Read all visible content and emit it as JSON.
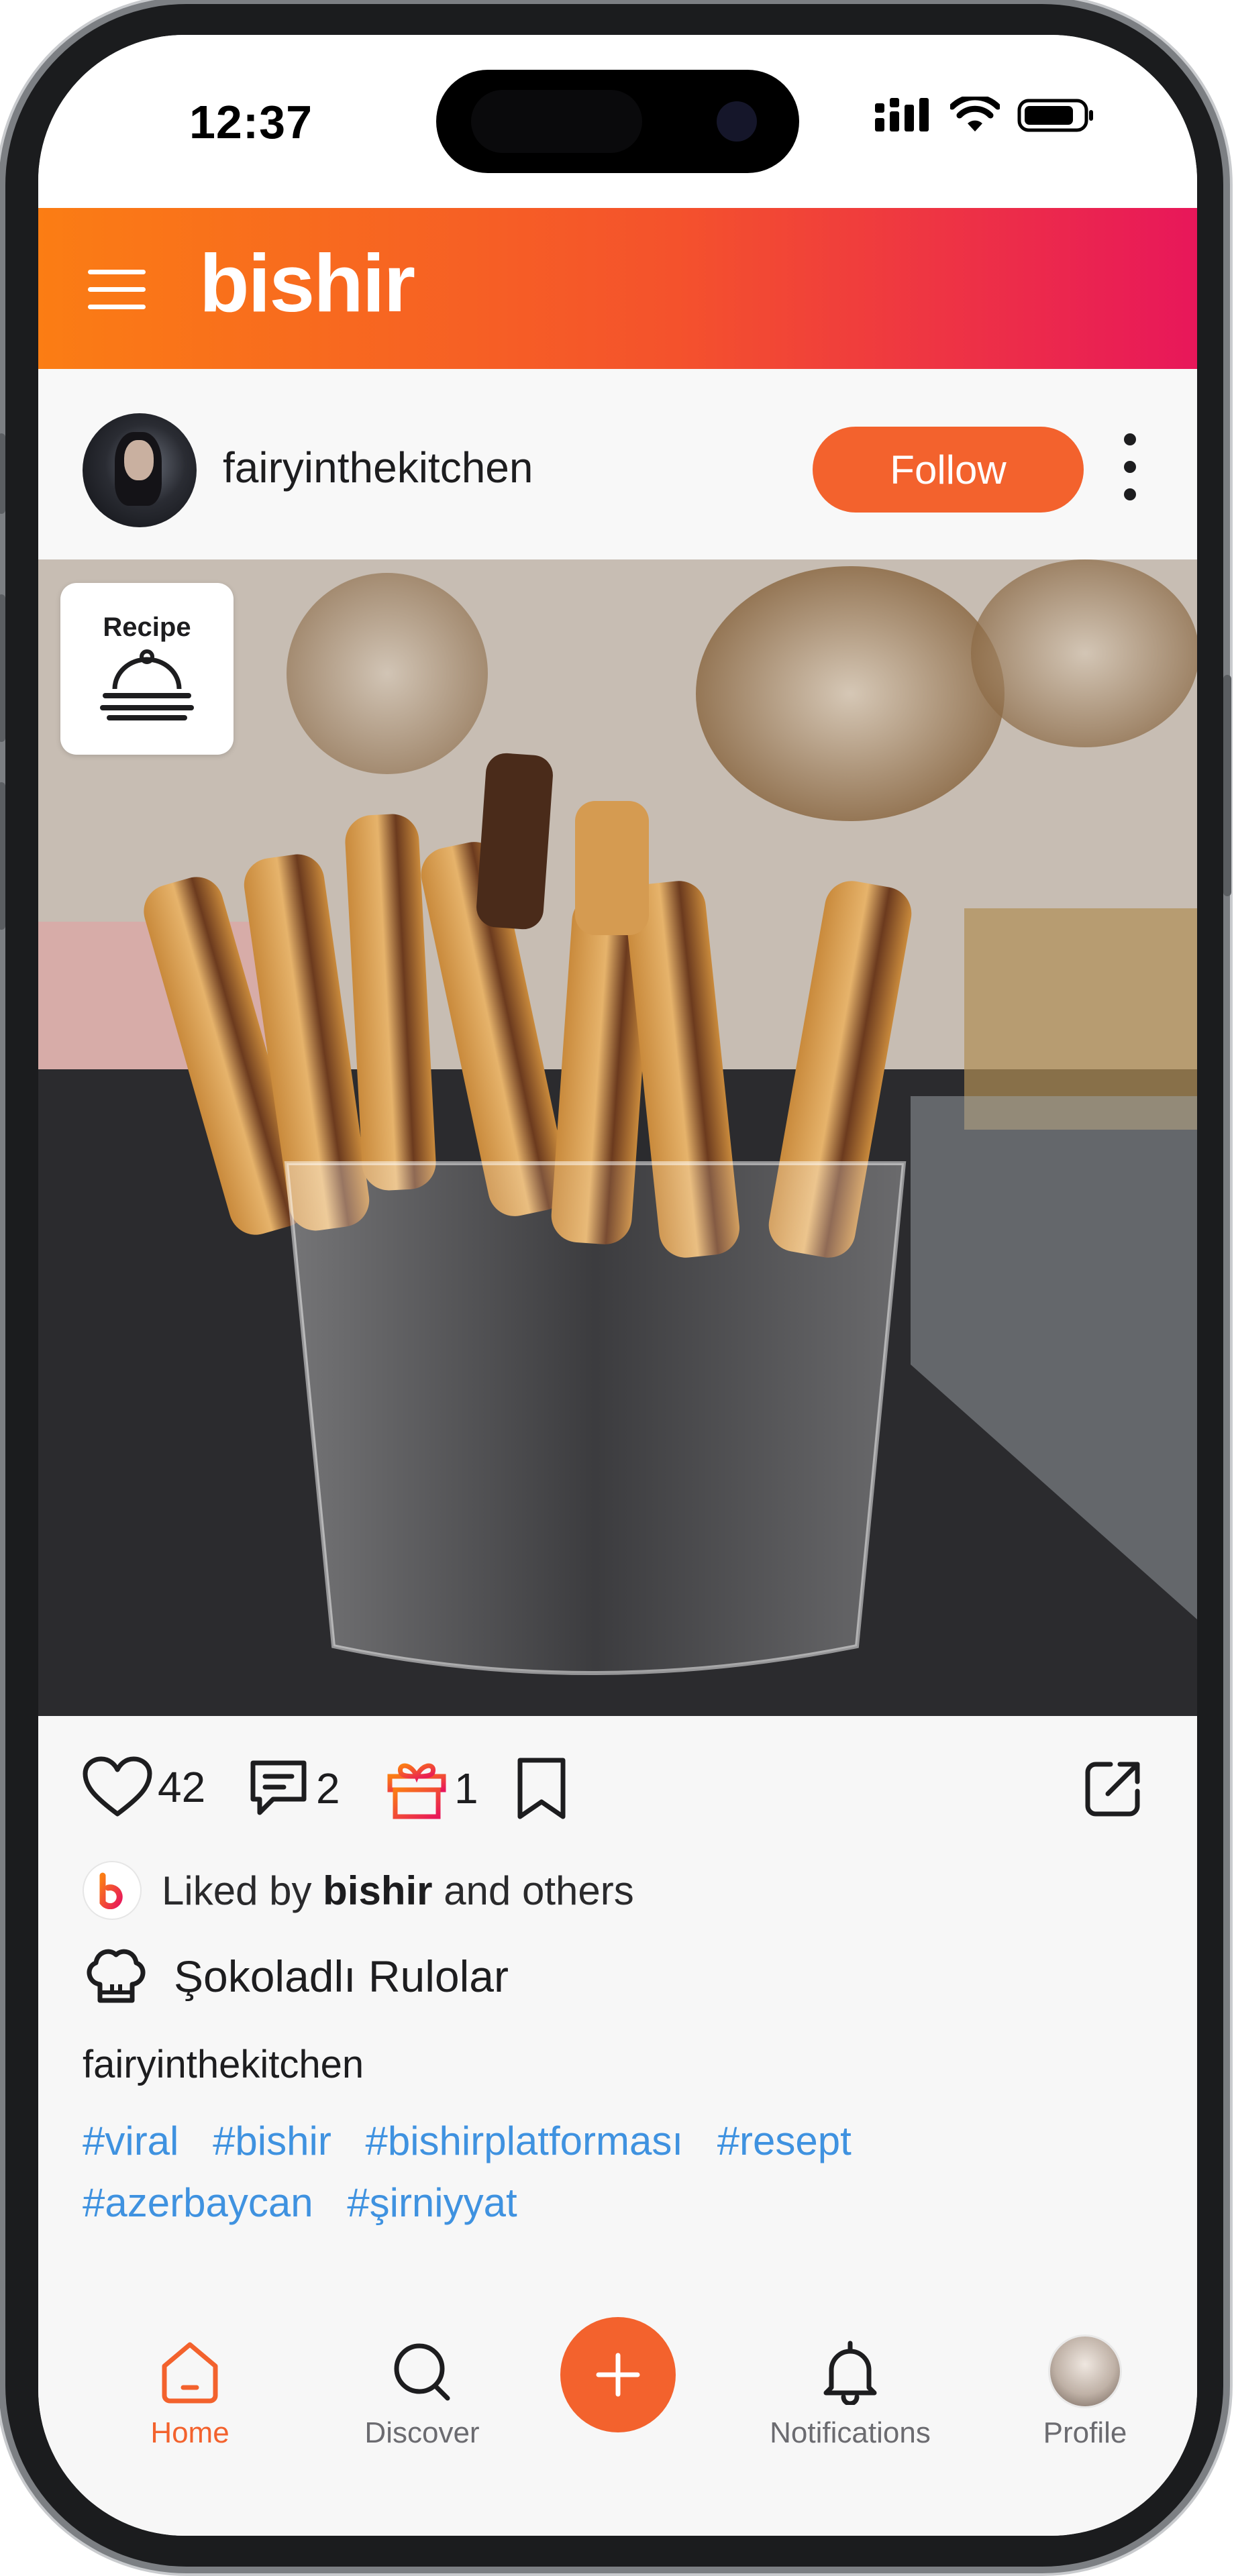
{
  "status_bar": {
    "time": "12:37"
  },
  "header": {
    "brand": "bishir"
  },
  "post": {
    "username": "fairyinthekitchen",
    "follow_label": "Follow",
    "badge_label": "Recipe",
    "likes": "42",
    "comments": "2",
    "gifts": "1",
    "liked_by_prefix": "Liked by",
    "liked_by_name": "bishir",
    "liked_by_suffix": "and others",
    "recipe_title": "Şokoladlı Rulolar",
    "caption_user": "fairyinthekitchen",
    "hashtags": [
      "#viral",
      "#bishir",
      "#bishirplatforması",
      "#resept",
      "#azerbaycan",
      "#şirniyyat"
    ]
  },
  "bottom_nav": {
    "items": [
      {
        "label": "Home",
        "icon": "home-icon",
        "active": true
      },
      {
        "label": "Discover",
        "icon": "search-icon",
        "active": false
      },
      {
        "label": "Notifications",
        "icon": "bell-icon",
        "active": false
      },
      {
        "label": "Profile",
        "icon": "profile-avatar",
        "active": false
      }
    ],
    "fab_icon": "plus-icon"
  },
  "colors": {
    "accent": "#f3622d",
    "header_gradient_start": "#fb7d14",
    "header_gradient_end": "#e8175a",
    "hashtag": "#3f92e0",
    "gift_icon_start": "#fb7d14",
    "gift_icon_end": "#e8175a"
  }
}
